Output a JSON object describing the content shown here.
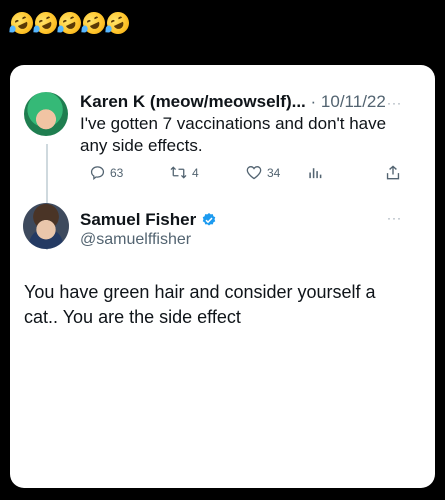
{
  "header": {
    "emoji": [
      "rofl-emoji",
      "rofl-emoji",
      "rofl-emoji",
      "rofl-emoji",
      "rofl-emoji"
    ]
  },
  "tweet1": {
    "name": "Karen K (meow/meowself)...",
    "separator": "·",
    "date": "10/11/22",
    "more": "···",
    "text": "I've gotten 7 vaccinations and don't have any side effects.",
    "replies": "63",
    "retweets": "4",
    "likes": "34"
  },
  "tweet2": {
    "name": "Samuel Fisher",
    "handle": "@samuelffisher",
    "more": "···",
    "text": "You have green hair and consider yourself a cat.. You are the side effect"
  },
  "colors": {
    "verified": "#1d9bf0",
    "muted": "#536471",
    "line": "#cfd9de"
  }
}
